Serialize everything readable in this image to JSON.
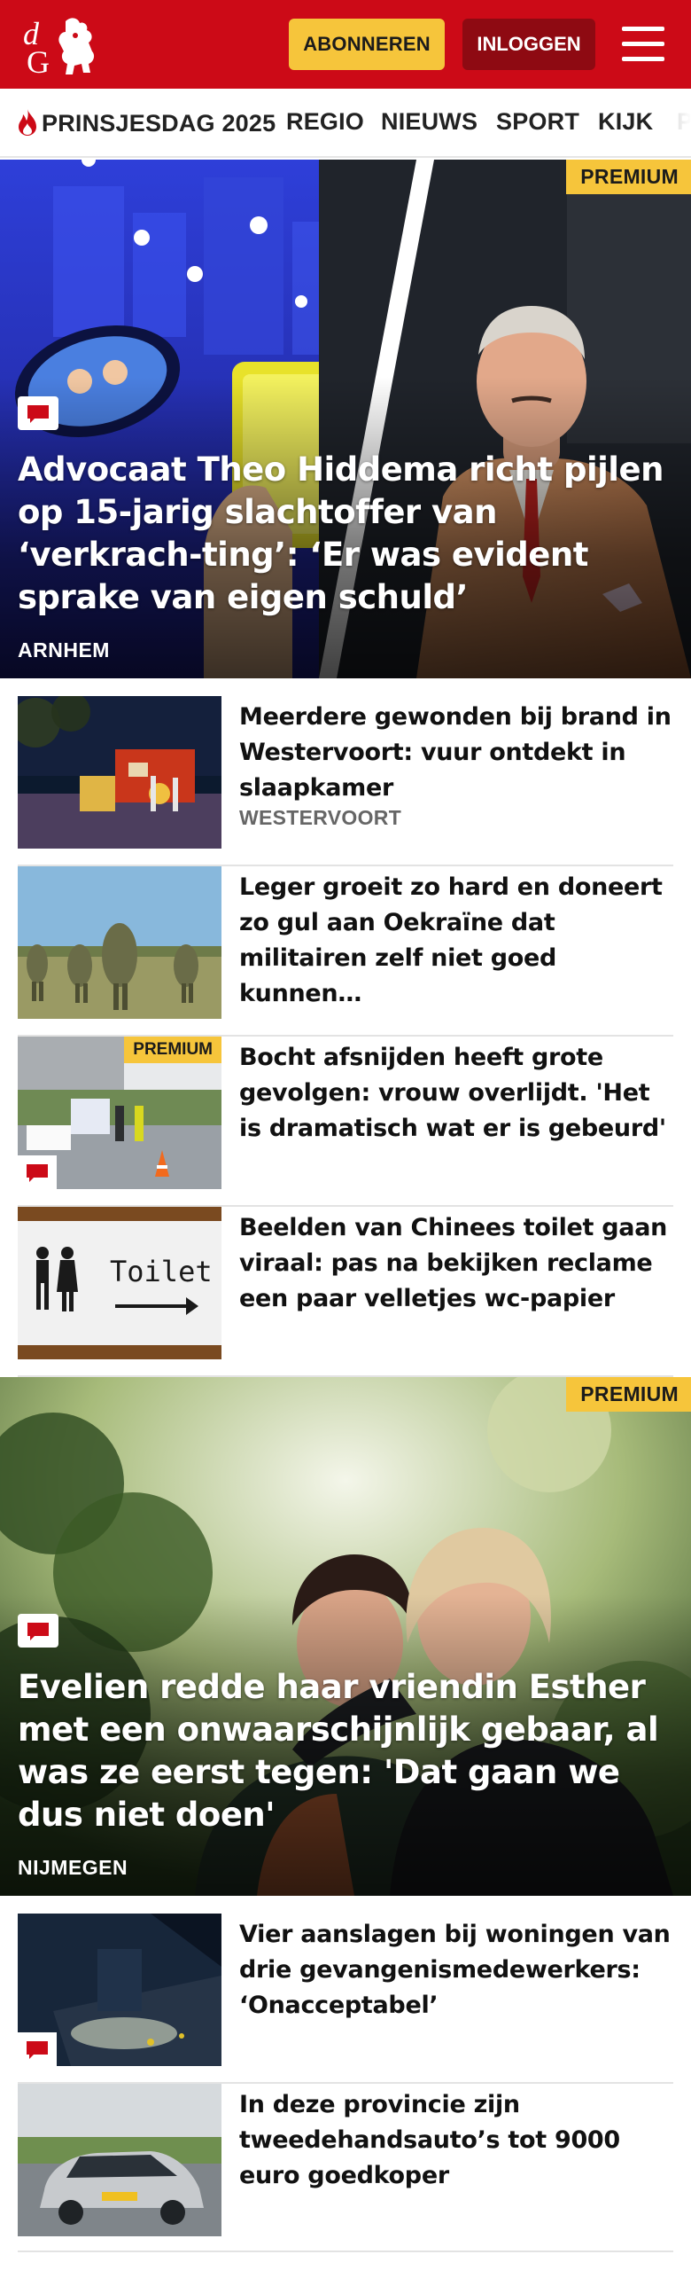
{
  "header": {
    "subscribe_label": "ABONNEREN",
    "login_label": "INLOGGEN",
    "brand_color": "#cc0a17",
    "accent_color": "#f6c53b"
  },
  "nav": {
    "items": [
      {
        "label": "PRINSJESDAG 2025",
        "icon": "flame-icon"
      },
      {
        "label": "REGIO"
      },
      {
        "label": "NIEUWS"
      },
      {
        "label": "SPORT"
      },
      {
        "label": "KIJK"
      }
    ]
  },
  "hero1": {
    "badge": "PREMIUM",
    "title": "Advocaat Theo Hiddema richt pijlen op 15-jarig slachtoffer van ‘verkrach-ting’: ‘Er was evident sprake van eigen schuld’",
    "location": "ARNHEM"
  },
  "articles": [
    {
      "title": "Meerdere gewonden bij brand in Westervoort: vuur ontdekt in slaapkamer",
      "location": "WESTERVOORT"
    },
    {
      "title": "Leger groeit zo hard en doneert zo gul aan Oekraïne dat militairen zelf niet goed kunnen…"
    },
    {
      "title": "Bocht afsnijden heeft grote gevolgen: vrouw overlijdt. 'Het is dramatisch wat er is gebeurd'",
      "badge": "PREMIUM"
    },
    {
      "title": "Beelden van Chinees toilet gaan viraal: pas na bekijken reclame een paar velletjes wc-papier",
      "sign_text": "Toilet"
    }
  ],
  "hero2": {
    "badge": "PREMIUM",
    "title": "Evelien redde haar vriendin Esther met een onwaarschijnlijk gebaar, al was ze eerst tegen: 'Dat gaan we dus niet doen'",
    "location": "NIJMEGEN"
  },
  "articles2": [
    {
      "title": "Vier aanslagen bij woningen van drie gevangenismedewerkers: ‘Onacceptabel’"
    },
    {
      "title": "In deze provincie zijn tweedehandsauto’s tot 9000 euro goedkoper"
    }
  ]
}
